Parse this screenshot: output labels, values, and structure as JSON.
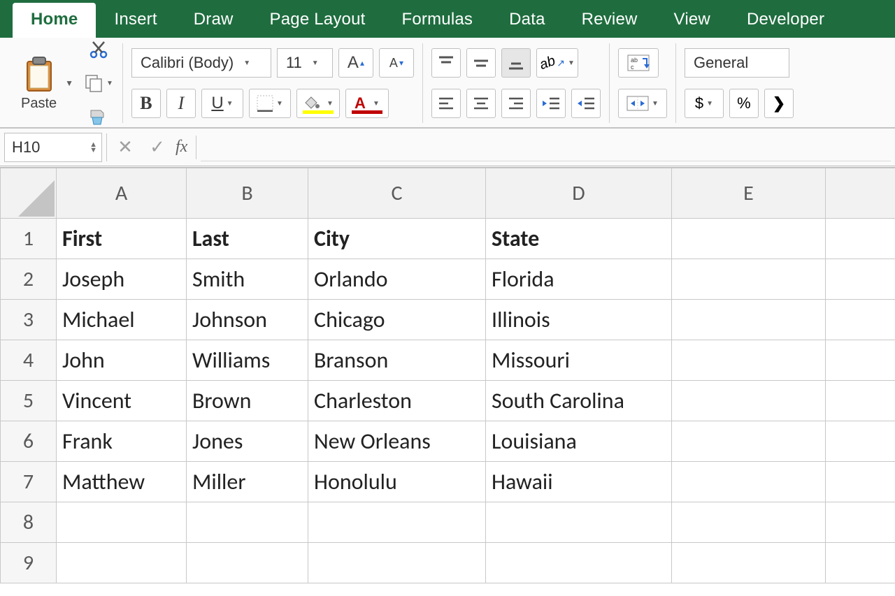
{
  "tabs": [
    "Home",
    "Insert",
    "Draw",
    "Page Layout",
    "Formulas",
    "Data",
    "Review",
    "View",
    "Developer"
  ],
  "activeTab": "Home",
  "font": {
    "name": "Calibri (Body)",
    "size": "11"
  },
  "numberFormat": "General",
  "pasteLabel": "Paste",
  "nameBox": "H10",
  "formula": "",
  "columns": [
    "A",
    "B",
    "C",
    "D",
    "E"
  ],
  "rows": [
    "1",
    "2",
    "3",
    "4",
    "5",
    "6",
    "7",
    "8",
    "9"
  ],
  "headers": {
    "A": "First",
    "B": "Last",
    "C": "City",
    "D": "State"
  },
  "data": [
    {
      "A": "Joseph",
      "B": "Smith",
      "C": "Orlando",
      "D": "Florida"
    },
    {
      "A": "Michael",
      "B": "Johnson",
      "C": "Chicago",
      "D": "Illinois"
    },
    {
      "A": "John",
      "B": "Williams",
      "C": "Branson",
      "D": "Missouri"
    },
    {
      "A": "Vincent",
      "B": "Brown",
      "C": "Charleston",
      "D": "South Carolina"
    },
    {
      "A": "Frank",
      "B": "Jones",
      "C": "New Orleans",
      "D": "Louisiana"
    },
    {
      "A": "Matthew",
      "B": "Miller",
      "C": "Honolulu",
      "D": "Hawaii"
    }
  ],
  "currency": "$",
  "percent": "%"
}
